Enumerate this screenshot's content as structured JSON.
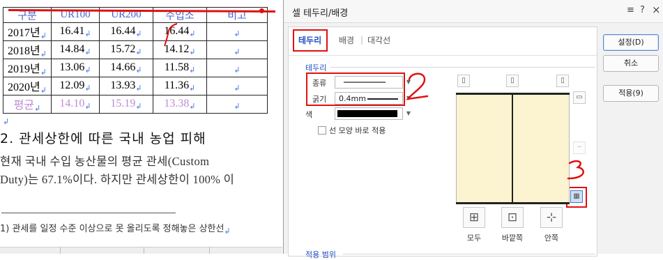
{
  "document": {
    "table": {
      "headers": [
        "구분",
        "UR100",
        "UR200",
        "수입소",
        "비고"
      ],
      "rows": [
        [
          "2017년",
          "16.41",
          "16.44",
          "16.44",
          ""
        ],
        [
          "2018년",
          "14.84",
          "15.72",
          "14.12",
          ""
        ],
        [
          "2019년",
          "13.06",
          "14.66",
          "11.58",
          ""
        ],
        [
          "2020년",
          "12.09",
          "13.93",
          "11.36",
          ""
        ]
      ],
      "average_row": [
        "평균",
        "14.10",
        "15.19",
        "13.38",
        ""
      ]
    },
    "heading": "2. 관세상한에 따른 국내 농업 피해",
    "para_line1": "현재 국내 수입 농산물의 평균 관세(Custom",
    "para_line2": "Duty)는 67.1%이다. 하지만 관세상한이 100% 이",
    "footnote": "1) 관세를 일정 수준 이상으로 못 올리도록 정해놓은 상한선",
    "paragraph_mark": "↲"
  },
  "dialog": {
    "title": "셀 테두리/배경",
    "title_icons": {
      "menu": "≡",
      "help": "?",
      "close": "×"
    },
    "tabs": [
      {
        "label": "테두리",
        "active": true
      },
      {
        "label": "배경",
        "active": false
      },
      {
        "label": "대각선",
        "active": false
      }
    ],
    "section_border": "테두리",
    "type_label": "종류",
    "width_label": "굵기",
    "width_value": "0.4mm",
    "color_label": "색",
    "color_value": "#000000",
    "apply_shape_label": "선 모양 바로 적용",
    "apply_shape_checked": false,
    "preset_buttons": [
      "모두",
      "바깥쪽",
      "안쪽"
    ],
    "section_range": "적용 범위",
    "buttons": {
      "ok": "설정(D)",
      "cancel": "취소",
      "apply": "적용(9)"
    }
  },
  "annotations": {
    "mark2": "2",
    "mark3": "3",
    "color": "#e01010"
  }
}
